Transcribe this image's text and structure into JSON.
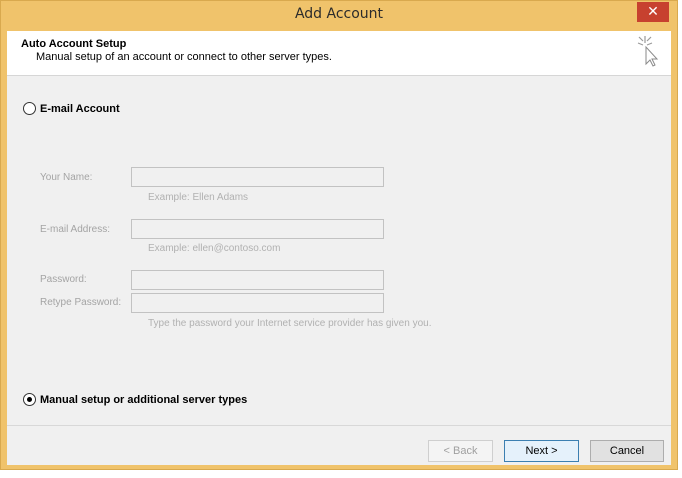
{
  "window": {
    "title": "Add Account",
    "close_glyph": "✕"
  },
  "header": {
    "title": "Auto Account Setup",
    "subtitle": "Manual setup of an account or connect to other server types.",
    "icon": "wizard-cursor-icon"
  },
  "email_option": {
    "label": "E-mail Account",
    "selected": false
  },
  "fields": {
    "your_name": {
      "label": "Your Name:",
      "value": "",
      "example": "Example: Ellen Adams"
    },
    "email_address": {
      "label": "E-mail Address:",
      "value": "",
      "example": "Example: ellen@contoso.com"
    },
    "password": {
      "label": "Password:",
      "value": ""
    },
    "retype_password": {
      "label": "Retype Password:",
      "value": "",
      "hint": "Type the password your Internet service provider has given you."
    }
  },
  "manual_option": {
    "label": "Manual setup or additional server types",
    "selected": true
  },
  "buttons": {
    "back": "< Back",
    "next": "Next >",
    "cancel": "Cancel"
  },
  "colors": {
    "frame": "#f0c36b",
    "close": "#c7412f",
    "client": "#f0f0f0"
  }
}
